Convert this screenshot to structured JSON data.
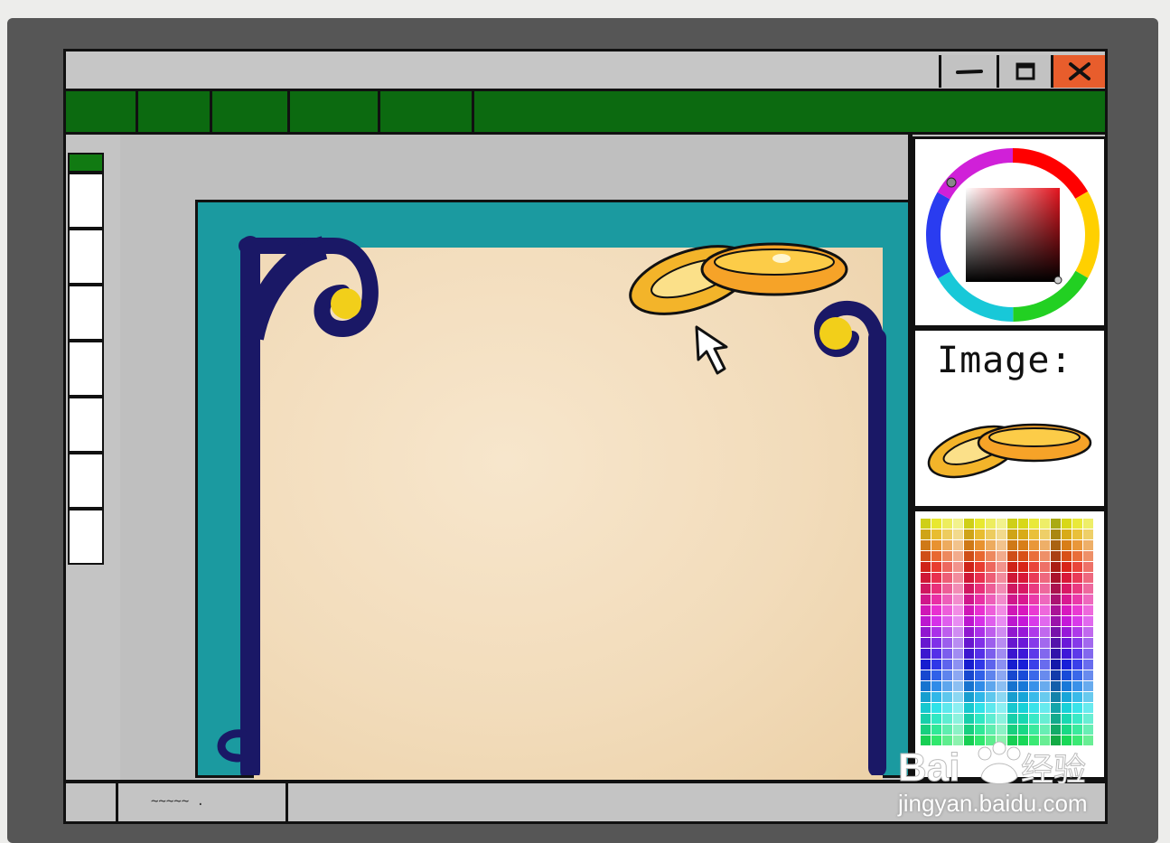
{
  "window": {
    "controls": {
      "minimize_icon": "minimize-icon",
      "maximize_icon": "maximize-icon",
      "close_icon": "close-icon",
      "close_color": "#e85d2c"
    },
    "menu_color": "#0c6a10"
  },
  "canvas": {
    "frame_color": "#1b9aa0",
    "paper_color": "#f2dcbb",
    "ornament_color": "#1a1866",
    "accent_color": "#f2cf1a",
    "rings_icon": "wedding-rings-icon",
    "cursor_icon": "arrow-cursor-icon"
  },
  "side_panel": {
    "color_picker_icon": "color-wheel-icon",
    "image_label": "Image:",
    "image_preview_icon": "wedding-rings-icon",
    "swatches_icon": "color-swatch-grid-icon"
  },
  "status_bar": {
    "field_text": "~~~~~ ."
  },
  "watermark": {
    "brand": "Baidu 经验",
    "url": "jingyan.baidu.com"
  }
}
